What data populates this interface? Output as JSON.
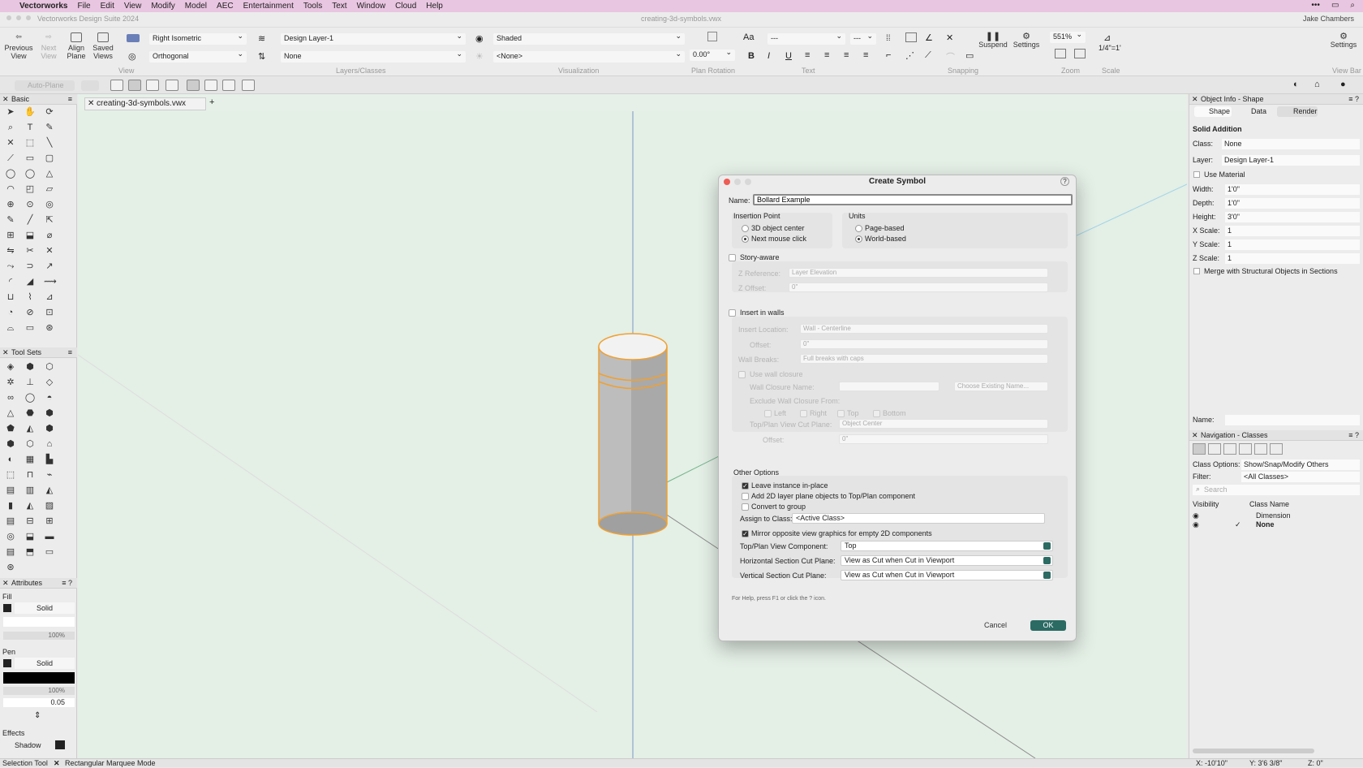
{
  "menubar": {
    "app": "Vectorworks",
    "items": [
      "File",
      "Edit",
      "View",
      "Modify",
      "Model",
      "AEC",
      "Entertainment",
      "Tools",
      "Text",
      "Window",
      "Cloud",
      "Help"
    ]
  },
  "titlebar": {
    "suite": "Vectorworks Design Suite 2024",
    "filename": "creating-3d-symbols.vwx",
    "user": "Jake Chambers"
  },
  "toolbar": {
    "previous_view": "Previous View",
    "next_view": "Next View",
    "align_plane": "Align Plane",
    "saved_views": "Saved Views",
    "view_select": "Right Isometric",
    "projection_select": "Orthogonal",
    "group_view": "View",
    "layer_select": "Design Layer-1",
    "class_select": "None",
    "group_layers": "Layers/Classes",
    "render_select": "Shaded",
    "lighting_select": "<None>",
    "group_visualization": "Visualization",
    "plan_rotation_value": "0.00°",
    "group_plan_rotation": "Plan Rotation",
    "font_select": "---",
    "size_select": "---",
    "group_text": "Text",
    "suspend": "Suspend",
    "settings_snap": "Settings",
    "group_snapping": "Snapping",
    "zoom_value": "551%",
    "group_zoom": "Zoom",
    "scale_value": "1/4\"=1'",
    "group_scale": "Scale",
    "settings": "Settings",
    "view_bar": "View Bar"
  },
  "toolbar2": {
    "auto_plane": "Auto-Plane"
  },
  "left": {
    "basic_title": "Basic",
    "toolsets_title": "Tool Sets",
    "attributes_title": "Attributes",
    "fill_label": "Fill",
    "fill_value": "Solid",
    "fill_opacity": "100%",
    "pen_label": "Pen",
    "pen_value": "Solid",
    "pen_opacity": "100%",
    "pen_weight": "0.05",
    "effects_label": "Effects",
    "shadow_label": "Shadow"
  },
  "doc_tab": "creating-3d-symbols.vwx",
  "object_info": {
    "title": "Object Info - Shape",
    "tabs": [
      "Shape",
      "Data",
      "Render"
    ],
    "object_type": "Solid Addition",
    "class_label": "Class:",
    "class_value": "None",
    "layer_label": "Layer:",
    "layer_value": "Design Layer-1",
    "use_material": "Use Material",
    "width_label": "Width:",
    "width_value": "1'0\"",
    "depth_label": "Depth:",
    "depth_value": "1'0\"",
    "height_label": "Height:",
    "height_value": "3'0\"",
    "xscale_label": "X Scale:",
    "xscale_value": "1",
    "yscale_label": "Y Scale:",
    "yscale_value": "1",
    "zscale_label": "Z Scale:",
    "zscale_value": "1",
    "merge_label": "Merge with Structural Objects in Sections",
    "name_label": "Name:"
  },
  "navigation": {
    "title": "Navigation - Classes",
    "options_label": "Class Options:",
    "options_value": "Show/Snap/Modify Others",
    "filter_label": "Filter:",
    "filter_value": "<All Classes>",
    "search_placeholder": "Search",
    "col_visibility": "Visibility",
    "col_name": "Class Name",
    "rows": [
      "Dimension",
      "None"
    ]
  },
  "status": {
    "tool": "Selection Tool",
    "mode": "Rectangular Marquee Mode",
    "x": "X: -10'10\"",
    "y": "Y: 3'6 3/8\"",
    "z": "Z: 0\""
  },
  "dialog": {
    "title": "Create Symbol",
    "name_label": "Name:",
    "name_value": "Bollard Example",
    "insertion_point": "Insertion Point",
    "opt_3d_center": "3D object center",
    "opt_next_click": "Next mouse click",
    "units": "Units",
    "opt_page": "Page-based",
    "opt_world": "World-based",
    "story_aware": "Story-aware",
    "z_reference": "Z Reference:",
    "z_reference_value": "Layer Elevation",
    "z_offset": "Z Offset:",
    "z_offset_value": "0\"",
    "insert_in_walls": "Insert in walls",
    "insert_location": "Insert Location:",
    "insert_location_value": "Wall - Centerline",
    "offset": "Offset:",
    "offset_value": "0\"",
    "wall_breaks": "Wall Breaks:",
    "wall_breaks_value": "Full breaks with caps",
    "use_wall_closure": "Use wall closure",
    "wall_closure_name": "Wall Closure Name:",
    "choose_existing": "Choose Existing Name...",
    "exclude_wall_closure": "Exclude Wall Closure From:",
    "ex_left": "Left",
    "ex_right": "Right",
    "ex_top": "Top",
    "ex_bottom": "Bottom",
    "top_plan_cut": "Top/Plan View Cut Plane:",
    "top_plan_cut_value": "Object Center",
    "offset2": "Offset:",
    "offset2_value": "0\"",
    "other_options": "Other Options",
    "leave_instance": "Leave instance in-place",
    "add_2d": "Add 2D layer plane objects to Top/Plan component",
    "convert_group": "Convert to group",
    "assign_class": "Assign to Class:",
    "assign_class_value": "<Active Class>",
    "mirror": "Mirror opposite view graphics for empty 2D components",
    "top_plan_component": "Top/Plan View Component:",
    "top_plan_component_value": "Top",
    "horiz_cut": "Horizontal Section Cut Plane:",
    "horiz_cut_value": "View as Cut when Cut in Viewport",
    "vert_cut": "Vertical Section Cut Plane:",
    "vert_cut_value": "View as Cut when Cut in Viewport",
    "help_text": "For Help, press F1 or click the ? icon.",
    "cancel": "Cancel",
    "ok": "OK",
    "help_q": "?"
  },
  "colors": {
    "accent": "#2b6b63",
    "menubar": "#e8c5e0",
    "selection": "#f0a030",
    "canvas": "#e4efe6"
  }
}
